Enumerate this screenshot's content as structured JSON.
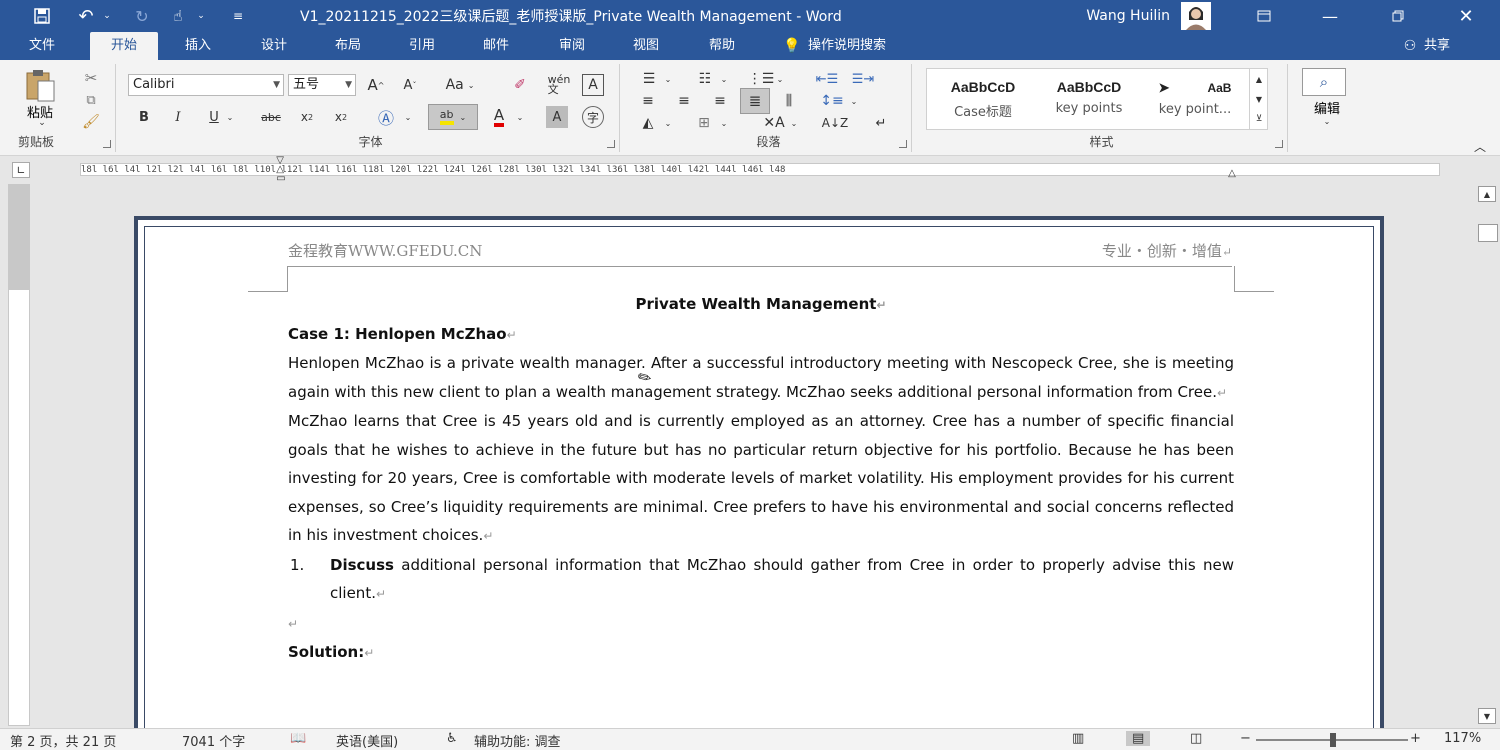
{
  "window": {
    "title": "V1_20211215_2022三级课后题_老师授课版_Private Wealth Management  -  Word",
    "user": "Wang Huilin"
  },
  "tabs": [
    "文件",
    "开始",
    "插入",
    "设计",
    "布局",
    "引用",
    "邮件",
    "审阅",
    "视图",
    "帮助",
    "操作说明搜索",
    "共享"
  ],
  "ribbon": {
    "clipboard": {
      "paste": "粘贴",
      "label": "剪贴板"
    },
    "font": {
      "name": "Calibri",
      "size": "五号",
      "label": "字体"
    },
    "paragraph": {
      "label": "段落"
    },
    "styles": {
      "items": [
        {
          "preview": "AaBbCcD",
          "name": "Case标题"
        },
        {
          "preview": "AaBbCcD",
          "name": "key points"
        },
        {
          "preview": "AaB",
          "name": "key point..."
        }
      ],
      "label": "样式"
    },
    "editing": {
      "label": "编辑"
    }
  },
  "ruler": "l8l l6l l4l l2l   l2l l4l l6l l8l l10l l12l l14l l16l l18l l20l l22l l24l l26l l28l l30l l32l l34l l36l l38l l40l l42l l44l l46l l48",
  "document": {
    "header_left": "金程教育WWW.GFEDU.CN",
    "header_right": "专业・创新・增值",
    "title": "Private Wealth Management",
    "case_heading": "Case 1: Henlopen McZhao",
    "para1": "Henlopen McZhao is a private wealth manager. After a successful introductory meeting with Nescopeck Cree, she is meeting again with this new client to plan a wealth management strategy. McZhao seeks additional personal information from Cree.",
    "para2": "McZhao learns that Cree is 45 years old and is currently employed as an attorney. Cree has a number of specific financial goals that he wishes to achieve in the future but has no particular return objective for his portfolio. Because he has been investing for 20 years, Cree is comfortable with moderate levels of market volatility. His employment provides for his current expenses, so Cree’s liquidity requirements are minimal. Cree prefers to have his environmental and social concerns reflected in his investment choices.",
    "q1_num": "1.",
    "q1_bold": "Discuss",
    "q1_text": " additional personal information that McZhao should gather from Cree in order to properly advise this new client.",
    "solution": "Solution:"
  },
  "status": {
    "page": "第 2 页，共 21 页",
    "words": "7041 个字",
    "lang": "英语(美国)",
    "access": "辅助功能: 调查",
    "zoom": "117%"
  }
}
